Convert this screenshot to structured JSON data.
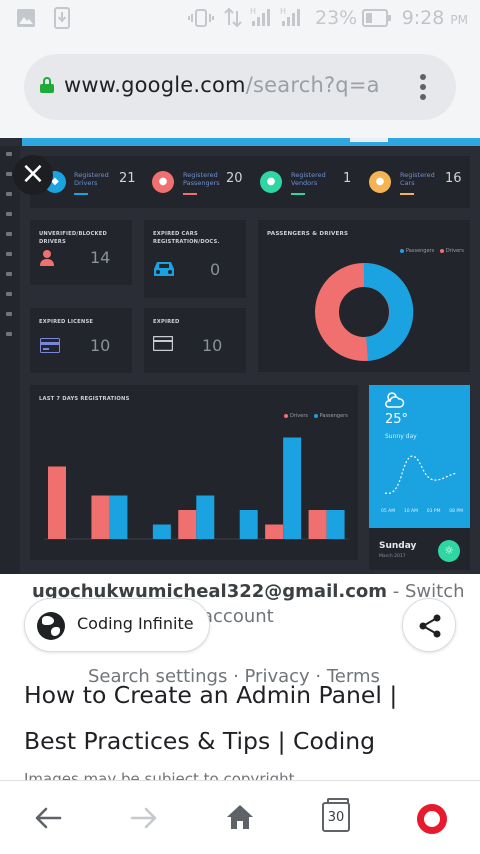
{
  "status_bar": {
    "battery_percent": "23%",
    "time": "9:28",
    "time_suffix": "PM",
    "icons": [
      "image-icon",
      "download-icon",
      "vibrate-icon",
      "data-transfer-icon",
      "signal-h-icon",
      "signal-h-icon",
      "battery-icon"
    ]
  },
  "browser": {
    "url_host": "www.google.com",
    "url_path": "/search?q=a",
    "tab_count": "30",
    "colors": {
      "lock": "#1faa3a",
      "opera": "#e8192c"
    }
  },
  "preview": {
    "stats": [
      {
        "label": "Registered\nDrivers",
        "value": "21",
        "color": "#1ba2e0"
      },
      {
        "label": "Registered\nPassengers",
        "value": "20",
        "color": "#f06f6f"
      },
      {
        "label": "Registered\nVendors",
        "value": "1",
        "color": "#2fd6a4"
      },
      {
        "label": "Registered\nCars",
        "value": "16",
        "color": "#f5b453"
      }
    ],
    "cards": [
      {
        "title": "UNVERIFIED/BLOCKED DRIVERS",
        "value": "14",
        "icon": "user-icon",
        "icon_color": "#f06f6f"
      },
      {
        "title": "EXPIRED CARS\nREGISTRATION/DOCS.",
        "value": "0",
        "icon": "car-icon",
        "icon_color": "#1ba2e0"
      },
      {
        "title": "EXPIRED LICENSE",
        "value": "10",
        "icon": "id-card-icon",
        "icon_color": "#7a86d8"
      },
      {
        "title": "EXPIRED",
        "value": "10",
        "icon": "card-icon",
        "icon_color": "#c9ccd2"
      }
    ],
    "donut": {
      "title": "PASSENGERS & DRIVERS",
      "legend": [
        "Passengers",
        "Drivers"
      ],
      "colors": [
        "#1ba2e0",
        "#f06f6f"
      ]
    },
    "bars": {
      "title": "LAST 7 DAYS REGISTRATIONS",
      "legend": [
        "Drivers",
        "Passengers"
      ],
      "colors": [
        "#f06f6f",
        "#1ba2e0"
      ]
    },
    "weather": {
      "temp": "25°",
      "condition": "Sunny day",
      "day": "Sunday",
      "date": "March 2017",
      "times": [
        "05 AM",
        "10 AM",
        "03 PM",
        "08 PM"
      ]
    }
  },
  "chart_data": {
    "type": "bar",
    "title": "LAST 7 DAYS REGISTRATIONS",
    "categories": [
      "",
      "",
      "",
      "",
      "",
      "",
      ""
    ],
    "series": [
      {
        "name": "Drivers",
        "values": [
          5,
          3,
          0,
          2,
          0,
          1,
          2
        ]
      },
      {
        "name": "Passengers",
        "values": [
          0,
          3,
          1,
          3,
          2,
          7,
          2
        ]
      }
    ],
    "ylim": [
      0,
      8
    ],
    "legend": "top-right",
    "grid": false
  },
  "result": {
    "email": "ugochukwumicheal322@gmail.com",
    "switch_text": " - Switch",
    "account_text": "account",
    "search_settings": "Search settings · Privacy · Terms",
    "source_name": "Coding Infinite",
    "title": "How to Create an Admin Panel | Best Practices & Tips | Coding",
    "copyright": "Images may be subject to copyright."
  }
}
